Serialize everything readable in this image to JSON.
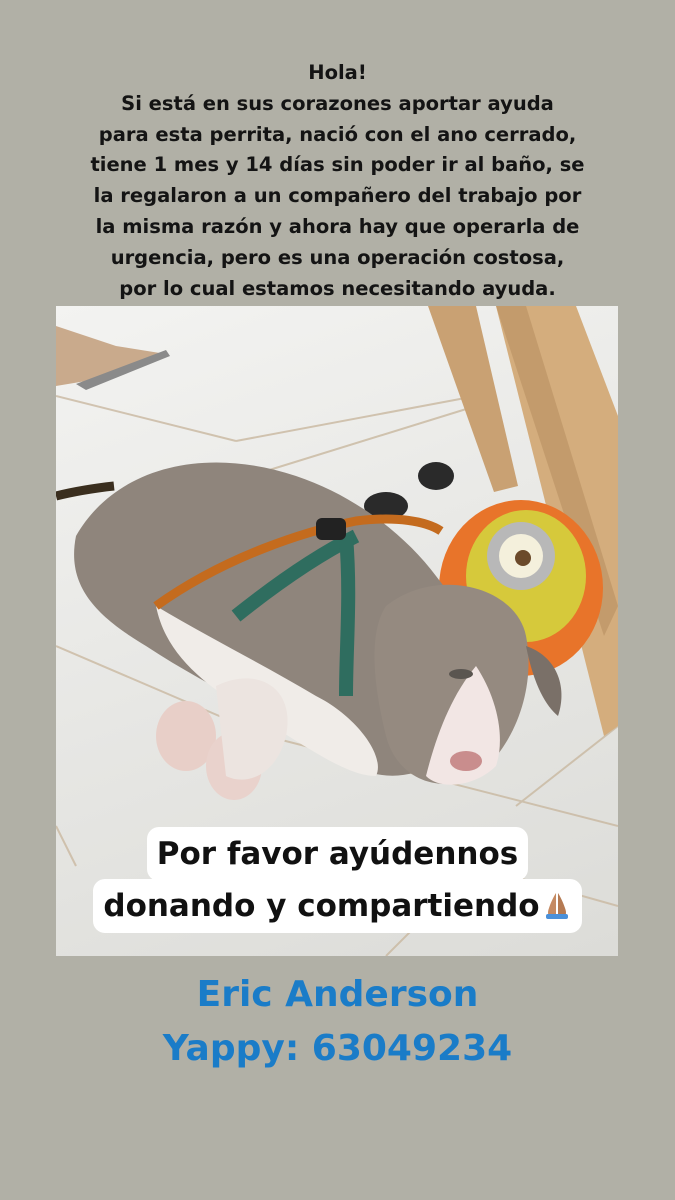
{
  "message": {
    "lines": [
      "Hola!",
      "Si está en sus corazones aportar ayuda",
      "para esta perrita, nació con el ano cerrado,",
      "tiene 1 mes y 14 días sin poder ir al baño, se",
      "la regalaron a un compañero del trabajo por",
      "la misma razón y ahora hay que operarla de",
      "urgencia, pero es una operación costosa,",
      "por lo cual estamos necesitando ayuda."
    ]
  },
  "photo": {
    "subject": "puppy-lying-on-tile-floor"
  },
  "caption": {
    "line1": "Por favor ayúdennos",
    "line2": "donando y compartiendo",
    "emoji": "praying-hands-icon"
  },
  "contact": {
    "name": "Eric Anderson",
    "yappy": "Yappy: 63049234"
  },
  "colors": {
    "background": "#b1b0a6",
    "contact_text": "#1a7cc8",
    "caption_bg": "#ffffff"
  }
}
